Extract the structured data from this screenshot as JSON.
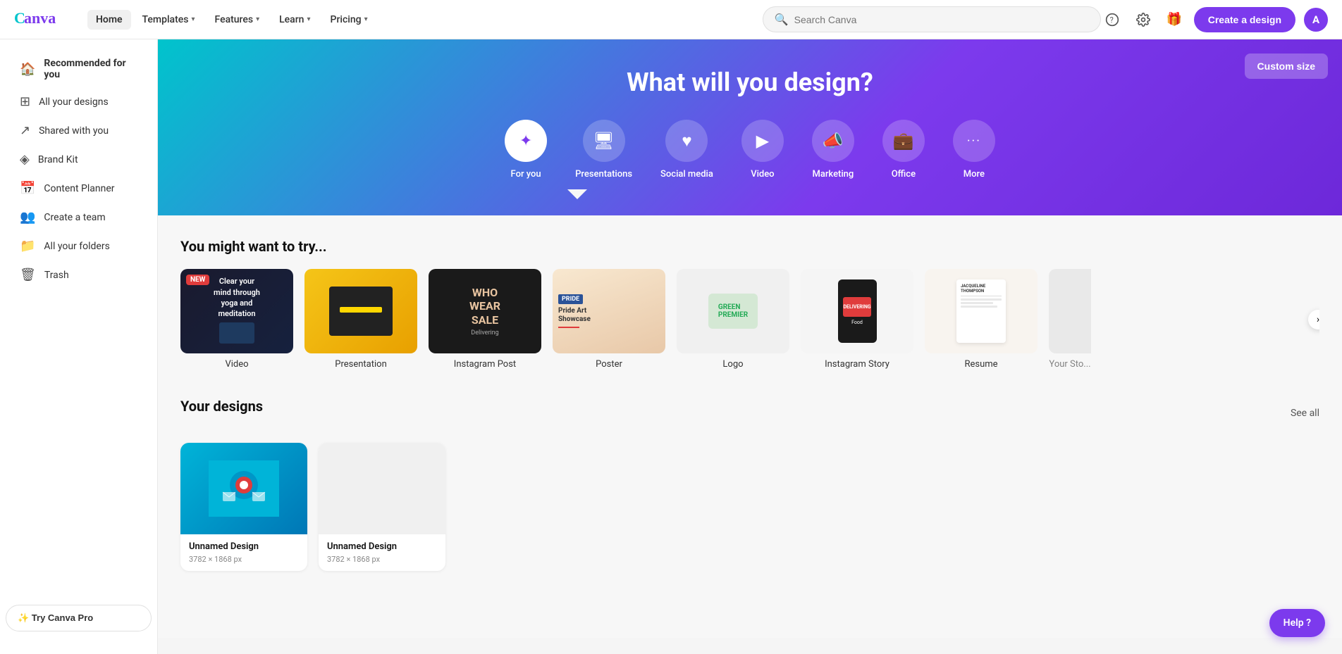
{
  "brand": {
    "logo_text": "Canva",
    "logo_color1": "#7c3aed",
    "logo_color2": "#00c4cc"
  },
  "topnav": {
    "active": "Home",
    "links": [
      {
        "label": "Home",
        "has_dropdown": false
      },
      {
        "label": "Templates",
        "has_dropdown": true
      },
      {
        "label": "Features",
        "has_dropdown": true
      },
      {
        "label": "Learn",
        "has_dropdown": true
      },
      {
        "label": "Pricing",
        "has_dropdown": true
      }
    ],
    "search_placeholder": "Search Canva",
    "create_btn": "Create a design",
    "avatar_letter": "A"
  },
  "sidebar": {
    "items": [
      {
        "label": "Recommended for you",
        "icon": "home"
      },
      {
        "label": "All your designs",
        "icon": "grid"
      },
      {
        "label": "Shared with you",
        "icon": "share"
      },
      {
        "label": "Brand Kit",
        "icon": "brand"
      },
      {
        "label": "Content Planner",
        "icon": "calendar"
      },
      {
        "label": "Create a team",
        "icon": "team"
      },
      {
        "label": "All your folders",
        "icon": "folder"
      },
      {
        "label": "Trash",
        "icon": "trash"
      }
    ],
    "try_pro_btn": "✨ Try Canva Pro"
  },
  "hero": {
    "title": "What will you design?",
    "custom_size_btn": "Custom size",
    "icons": [
      {
        "label": "For you",
        "icon": "✦",
        "active": true
      },
      {
        "label": "Presentations",
        "icon": "🖥"
      },
      {
        "label": "Social media",
        "icon": "♥"
      },
      {
        "label": "Video",
        "icon": "▶"
      },
      {
        "label": "Marketing",
        "icon": "📣"
      },
      {
        "label": "Office",
        "icon": "💼"
      },
      {
        "label": "More",
        "icon": "•••"
      }
    ]
  },
  "try_section": {
    "title": "You might want to try...",
    "templates": [
      {
        "label": "Video",
        "is_new": true
      },
      {
        "label": "Presentation",
        "is_new": false
      },
      {
        "label": "Instagram Post",
        "is_new": false
      },
      {
        "label": "Poster",
        "is_new": false
      },
      {
        "label": "Logo",
        "is_new": false
      },
      {
        "label": "Instagram Story",
        "is_new": false
      },
      {
        "label": "Resume",
        "is_new": false
      },
      {
        "label": "Your Sto...",
        "is_new": false
      }
    ],
    "new_badge": "NEW"
  },
  "designs_section": {
    "title": "Your designs",
    "see_all": "See all",
    "designs": [
      {
        "name": "Unnamed Design",
        "size": "3782 × 1868 px"
      },
      {
        "name": "Unnamed Design",
        "size": "3782 × 1868 px"
      }
    ]
  },
  "help": {
    "btn_label": "Help ?"
  }
}
